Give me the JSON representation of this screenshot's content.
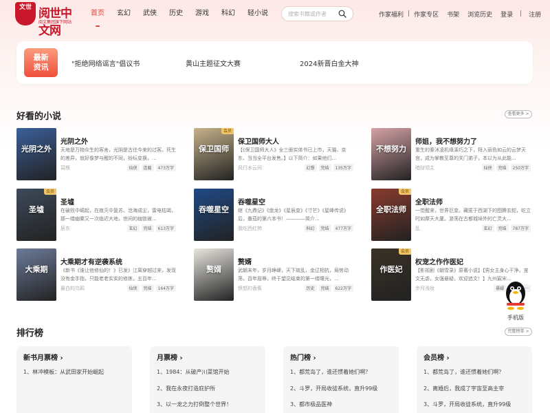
{
  "header": {
    "logo_seal": "文世",
    "logo_main": "阅世中文网",
    "logo_sub": "阅文集团旗下网站",
    "nav": [
      {
        "label": "首页",
        "active": true
      },
      {
        "label": "玄幻"
      },
      {
        "label": "武侠"
      },
      {
        "label": "历史"
      },
      {
        "label": "游戏"
      },
      {
        "label": "科幻"
      },
      {
        "label": "轻小说"
      }
    ],
    "search_placeholder": "搜索书籍或作者",
    "links": {
      "author_welfare": "作家福利",
      "author_zone": "作家专区",
      "bookshelf": "书架",
      "history": "浏览历史",
      "login": "登录",
      "register": "注册"
    }
  },
  "banner": {
    "badge": "最新资讯",
    "links": [
      "\"拒绝网络谣言\"倡议书",
      "黄山主题征文大赛",
      "2024新晋白金大神"
    ]
  },
  "good_books": {
    "title": "好看的小说",
    "more": "查看更多 >",
    "vip_label": "会员",
    "books": [
      {
        "title": "光阴之外",
        "desc": "天地是万物众生的客舍，光阴是古往今来的过客。死生的差异，就好像梦与醒的不同，纷纭变换，...",
        "author": "耳根",
        "tags": [
          "仙侠",
          "连载",
          "473万字"
        ],
        "cover_text": "光阴之外",
        "cover_color": "#3b5f9a",
        "vip": false
      },
      {
        "title": "保卫国师大人",
        "desc": "【《保卫国师大人》全三册实体书已上市，天猫、京东、当当全平台发售。】以下简介：如果他们...",
        "author": "风行水云间",
        "tags": [
          "幻想",
          "完结",
          "135万字"
        ],
        "cover_text": "保卫国师",
        "cover_color": "#c7b38b",
        "vip": true
      },
      {
        "title": "师姐，我不想努力了",
        "desc": "重生的秦沐凌机缘凑巧之下，拜入丽色如云的云梦天宫，成为掌教至尊的关门弟子，本以为从此能...",
        "author": "暗狱领主",
        "tags": [
          "仙侠",
          "完结",
          "250万字"
        ],
        "cover_text": "不想努力",
        "cover_color": "#d6a2a6",
        "vip": false
      },
      {
        "title": "圣墟",
        "desc": "在破败中崛起，在寂灭中复苏。沧海成尘，雷电枯竭，那一缕幽雾又一次临近大地，世间的枷锁被...",
        "author": "辰东",
        "tags": [
          "玄幻",
          "完结",
          "613万字"
        ],
        "cover_text": "圣墟",
        "cover_color": "#3d4a5a",
        "vip": true
      },
      {
        "title": "吞噬星空",
        "desc": "继《九鼎记》《盘龙》《星辰变》《寸芒》《星峰传说》后，番茄的第六本书！————简介...",
        "author": "我吃西红柿",
        "tags": [
          "科幻",
          "完结",
          "477万字"
        ],
        "cover_text": "吞噬星空",
        "cover_color": "#1f4a86",
        "vip": false
      },
      {
        "title": "全职法师",
        "desc": "一觉醒来，世界巨变。藏匿于西湖下的图腾玄蛇，屹立时如摩天大厦。游荡在古都城垛外的亡灵大...",
        "author": "乱",
        "tags": [
          "玄幻",
          "完结",
          "787万字"
        ],
        "cover_text": "全职法师",
        "cover_color": "#8a3b2e",
        "vip": true
      },
      {
        "title": "大乘期才有逆袭系统",
        "desc": "《新书《谁让他修仙的！》已发》江离穿越过来，发现没有金手指，只能老老实实的修炼，五百年...",
        "author": "最白的乌鸦",
        "tags": [
          "仙侠",
          "完结",
          "164万字"
        ],
        "cover_text": "大乘期",
        "cover_color": "#6d7b9a",
        "vip": false
      },
      {
        "title": "赘婿",
        "desc": "武朝末年，岁月峥嵘，天下故乱，金辽相抗，局势动荡，百年屈辱，终于望见结束的第一缕曙光，...",
        "author": "愤怒的香蕉",
        "tags": [
          "历史",
          "完结",
          "622万字"
        ],
        "cover_text": "赘婿",
        "cover_color": "#e9e6df",
        "vip": false
      },
      {
        "title": "权宠之作作医妃",
        "desc": "【影视剧《朝雪录》原著小说】【男女主身心干净，宠文无虐，女强悬疑，欢迎追文！】九州宸宋...",
        "author": "步月浅妆",
        "tags": [
          "悬疑",
          "完结",
          "..."
        ],
        "cover_text": "作医妃",
        "cover_color": "#3a3226",
        "vip": true
      }
    ]
  },
  "mobile": {
    "label": "手机版"
  },
  "rankings": {
    "title": "排行榜",
    "more": "完整榜单 >",
    "lists": [
      {
        "title": "新书月票榜",
        "items": [
          "1、林冲模板：从武田家开始崛起"
        ]
      },
      {
        "title": "月票榜",
        "items": [
          "1、1984：从破产川菜馆开始",
          "2、我在永夜打造庇护所",
          "3、以一龙之力打倒整个世界！"
        ]
      },
      {
        "title": "热门榜",
        "items": [
          "1、都荒岛了，谁还惯着她们啊？",
          "2、斗罗，开局收徒系统，直升99级",
          "3、都市极品医神"
        ]
      },
      {
        "title": "会员榜",
        "items": [
          "1、都荒岛了，谁还惯着她们啊？",
          "2、离婚后，我成了宇宙至高主宰",
          "3、斗罗，开局收徒系统，直升99级"
        ]
      }
    ]
  },
  "colors": {
    "accent": "#e2433a",
    "brand": "#c9182b"
  }
}
